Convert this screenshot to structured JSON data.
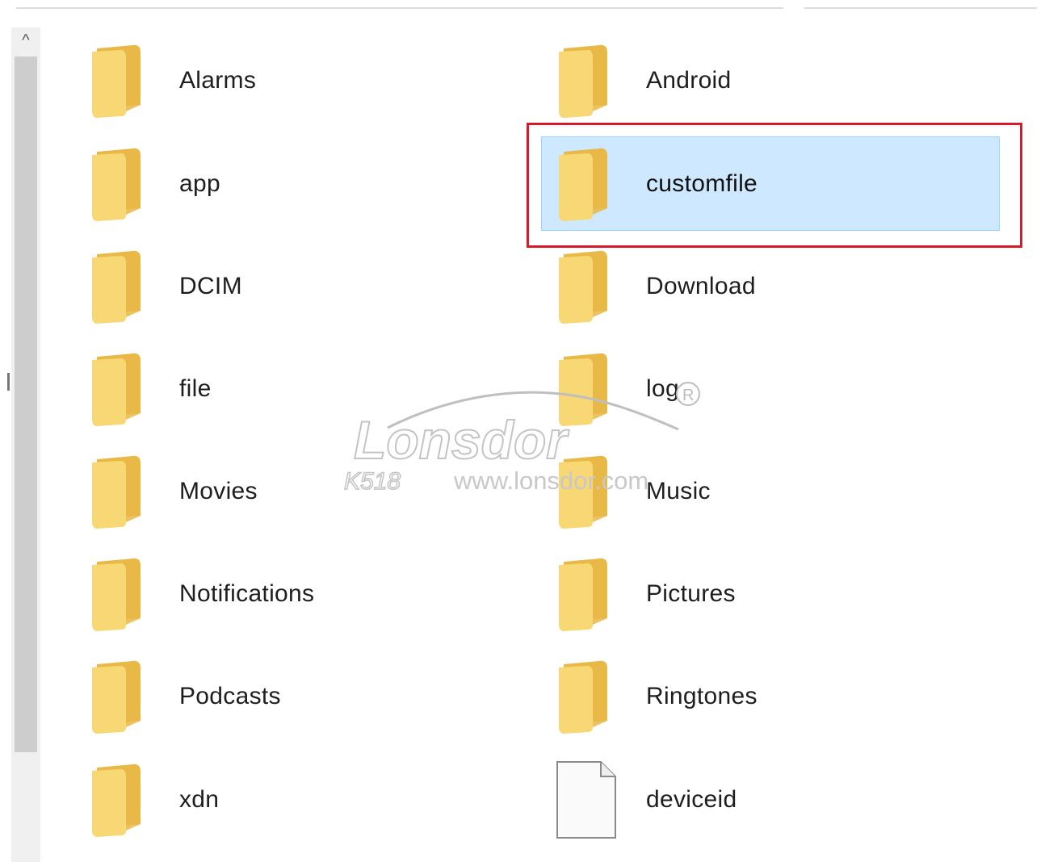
{
  "colors": {
    "folder": "#f8d775",
    "folder_dark": "#e8b946",
    "selection_bg": "#cde8ff",
    "selection_border": "#99d1ff",
    "highlight_box": "#d51b2b"
  },
  "scrollbar": {
    "up_arrow": "^"
  },
  "items": [
    {
      "label": "Alarms",
      "icon": "folder-icon",
      "selected": false
    },
    {
      "label": "Android",
      "icon": "folder-icon",
      "selected": false
    },
    {
      "label": "app",
      "icon": "folder-icon",
      "selected": false
    },
    {
      "label": "customfile",
      "icon": "folder-icon",
      "selected": true
    },
    {
      "label": "DCIM",
      "icon": "folder-icon",
      "selected": false
    },
    {
      "label": "Download",
      "icon": "folder-icon",
      "selected": false
    },
    {
      "label": "file",
      "icon": "folder-icon",
      "selected": false
    },
    {
      "label": "log",
      "icon": "folder-icon",
      "selected": false
    },
    {
      "label": "Movies",
      "icon": "folder-icon",
      "selected": false
    },
    {
      "label": "Music",
      "icon": "folder-icon",
      "selected": false
    },
    {
      "label": "Notifications",
      "icon": "folder-icon",
      "selected": false
    },
    {
      "label": "Pictures",
      "icon": "folder-icon",
      "selected": false
    },
    {
      "label": "Podcasts",
      "icon": "folder-icon",
      "selected": false
    },
    {
      "label": "Ringtones",
      "icon": "folder-icon",
      "selected": false
    },
    {
      "label": "xdn",
      "icon": "folder-icon",
      "selected": false
    },
    {
      "label": "deviceid",
      "icon": "file-icon",
      "selected": false
    }
  ],
  "watermark": {
    "brand": "Lonsdor",
    "model": "K518",
    "url": "www.lonsdor.com",
    "registered": "R"
  }
}
